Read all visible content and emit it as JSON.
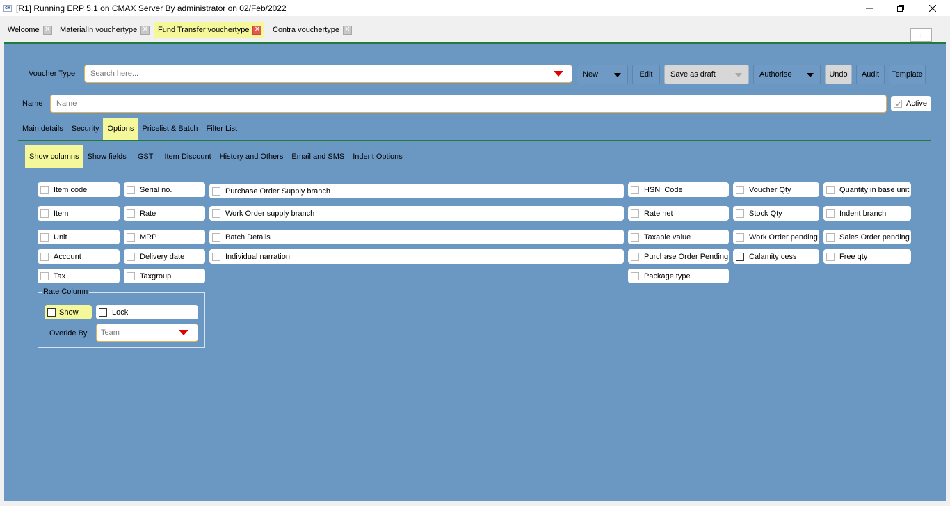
{
  "window": {
    "icon_text": "cx",
    "title": "[R1] Running ERP 5.1 on CMAX Server By administrator on 02/Feb/2022"
  },
  "tabs": [
    {
      "label": "Welcome",
      "active": false
    },
    {
      "label": "MaterialIn vouchertype",
      "active": false
    },
    {
      "label": "Fund Transfer vouchertype",
      "active": true
    },
    {
      "label": "Contra vouchertype",
      "active": false
    }
  ],
  "plus_label": "+",
  "toolbar": {
    "voucher_type_label": "Voucher Type",
    "search_placeholder": "Search here...",
    "new_label": "New",
    "edit_label": "Edit",
    "save_draft_label": "Save as draft",
    "authorise_label": "Authorise",
    "undo_label": "Undo",
    "audit_label": "Audit",
    "template_label": "Template"
  },
  "name_row": {
    "label": "Name",
    "placeholder": "Name",
    "active_label": "Active",
    "active_checked": true
  },
  "main_tabs": [
    {
      "label": "Main details",
      "selected": false
    },
    {
      "label": "Security",
      "selected": false
    },
    {
      "label": "Options",
      "selected": true
    },
    {
      "label": "Pricelist & Batch",
      "selected": false
    },
    {
      "label": "Filter List",
      "selected": false
    }
  ],
  "sub_tabs": [
    {
      "label": "Show columns",
      "selected": true
    },
    {
      "label": "Show fields",
      "selected": false
    },
    {
      "label": "GST",
      "selected": false
    },
    {
      "label": "Item Discount",
      "selected": false
    },
    {
      "label": "History and Others",
      "selected": false
    },
    {
      "label": "Email and SMS",
      "selected": false
    },
    {
      "label": "Indent Options",
      "selected": false
    }
  ],
  "columns": {
    "col1": [
      "Item code",
      "Item",
      "Unit",
      "Account",
      "Tax"
    ],
    "col2": [
      "Serial no.",
      "Rate",
      "MRP",
      "Delivery date",
      "Taxgroup"
    ],
    "col3": [
      "Purchase Order Supply branch",
      "Work Order supply branch",
      "Batch Details",
      "Individual narration"
    ],
    "col4": [
      "HSN  Code",
      "Rate net",
      "Taxable value",
      "Purchase Order Pending",
      "Package type"
    ],
    "col5": [
      "Voucher Qty",
      "Stock Qty",
      "Work Order pending",
      "Calamity cess"
    ],
    "col6": [
      "Quantity in base unit",
      "Indent branch",
      "Sales Order pending",
      "Free qty"
    ]
  },
  "rate_column": {
    "legend": "Rate Column",
    "show_label": "Show",
    "lock_label": "Lock",
    "override_label": "Overide By",
    "override_value": "Team"
  },
  "colors": {
    "panel": "#6b97c3",
    "highlight": "#f4f79a",
    "accent_line": "#1f7a3c",
    "input_border": "#e3b255",
    "dropdown_arrow": "#e00000"
  }
}
